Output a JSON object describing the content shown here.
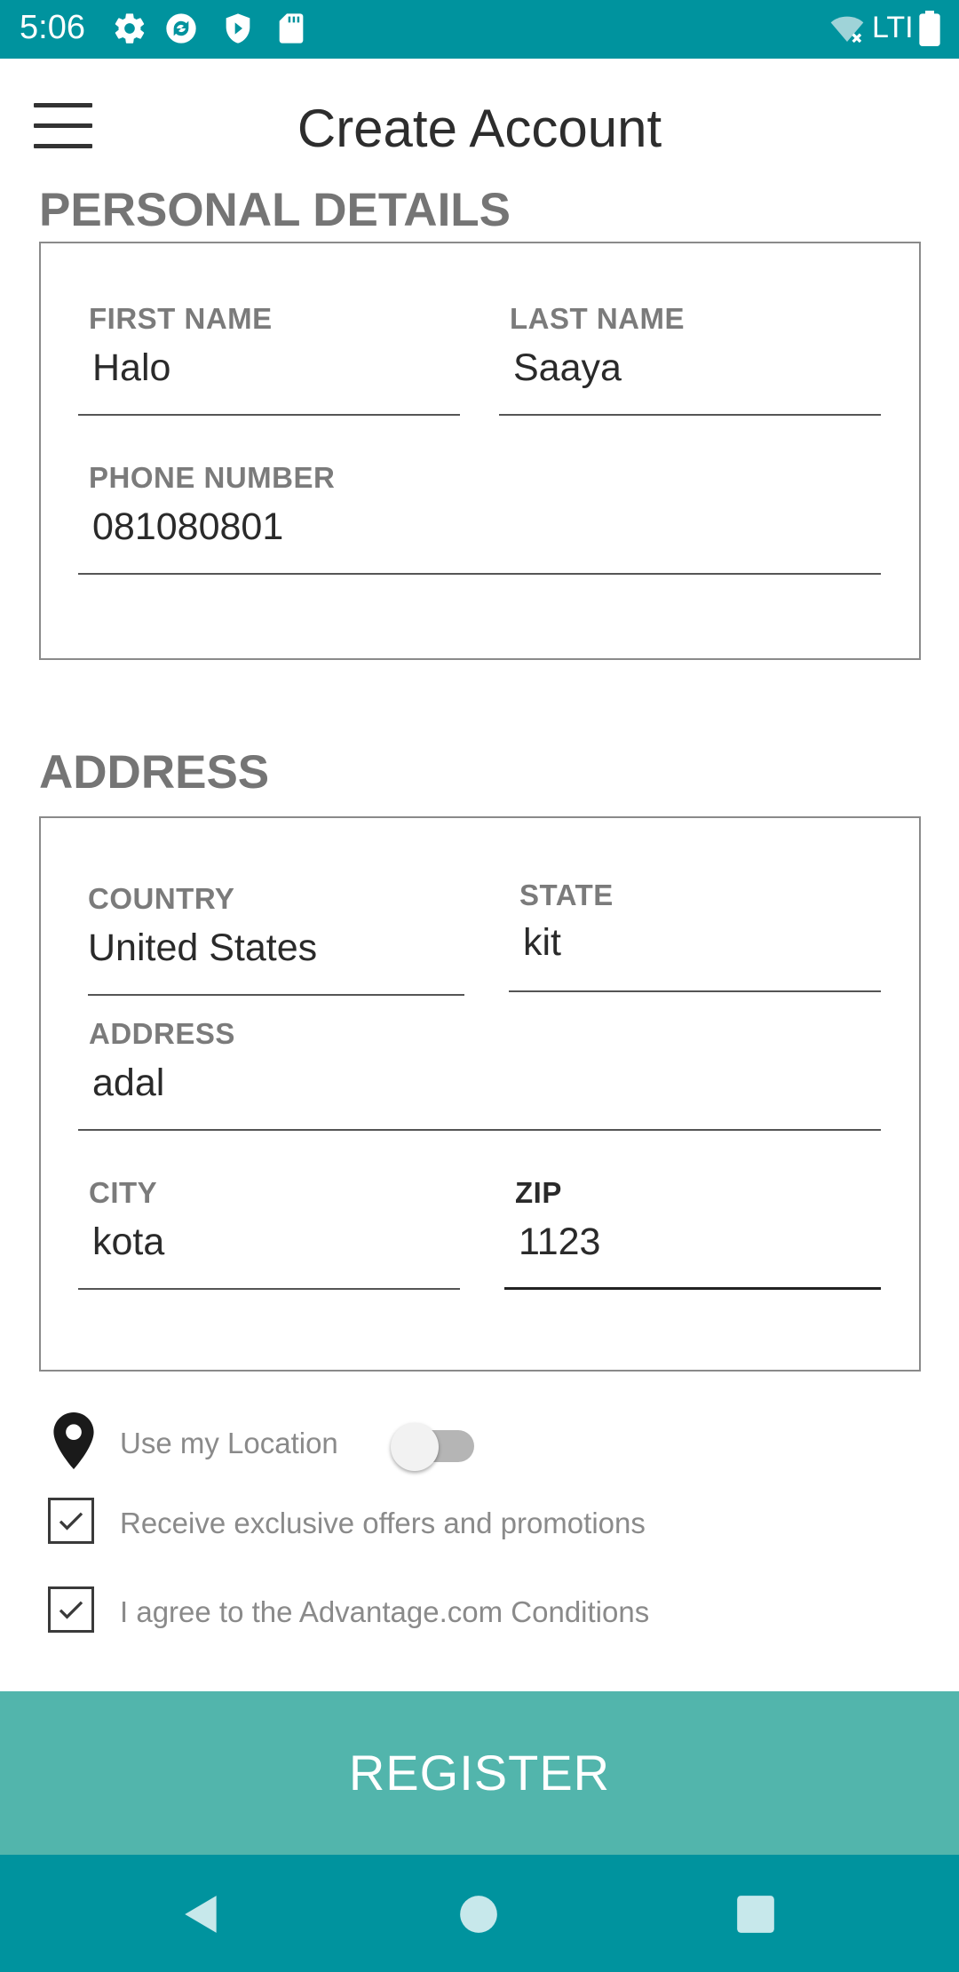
{
  "status_bar": {
    "time": "5:06",
    "network_label": "LTI",
    "icons": [
      "gear-icon",
      "sync-icon",
      "shield-icon",
      "sdcard-icon",
      "wifi-off-icon",
      "battery-icon"
    ]
  },
  "header": {
    "title": "Create Account",
    "menu_icon": "hamburger-menu-icon"
  },
  "personal_details": {
    "section_title": "PERSONAL DETAILS",
    "first_name": {
      "label": "FIRST NAME",
      "value": "Halo"
    },
    "last_name": {
      "label": "LAST NAME",
      "value": "Saaya"
    },
    "phone_number": {
      "label": "PHONE NUMBER",
      "value": "081080801"
    }
  },
  "address": {
    "section_title": "ADDRESS",
    "country": {
      "label": "COUNTRY",
      "value": "United States"
    },
    "state": {
      "label": "STATE",
      "value": "kit"
    },
    "address": {
      "label": "ADDRESS",
      "value": "adal"
    },
    "city": {
      "label": "CITY",
      "value": "kota"
    },
    "zip": {
      "label": "ZIP",
      "value": "1123"
    }
  },
  "options": {
    "use_location": {
      "label": "Use my Location",
      "enabled": false
    },
    "offers": {
      "label": "Receive exclusive offers and promotions",
      "checked": true
    },
    "conditions": {
      "label": "I agree to the Advantage.com Conditions",
      "checked": true
    }
  },
  "register": {
    "label": "REGISTER"
  },
  "colors": {
    "status_bar": "#00939e",
    "register_button": "#52b5ac",
    "label_gray": "#7b7b7b"
  }
}
